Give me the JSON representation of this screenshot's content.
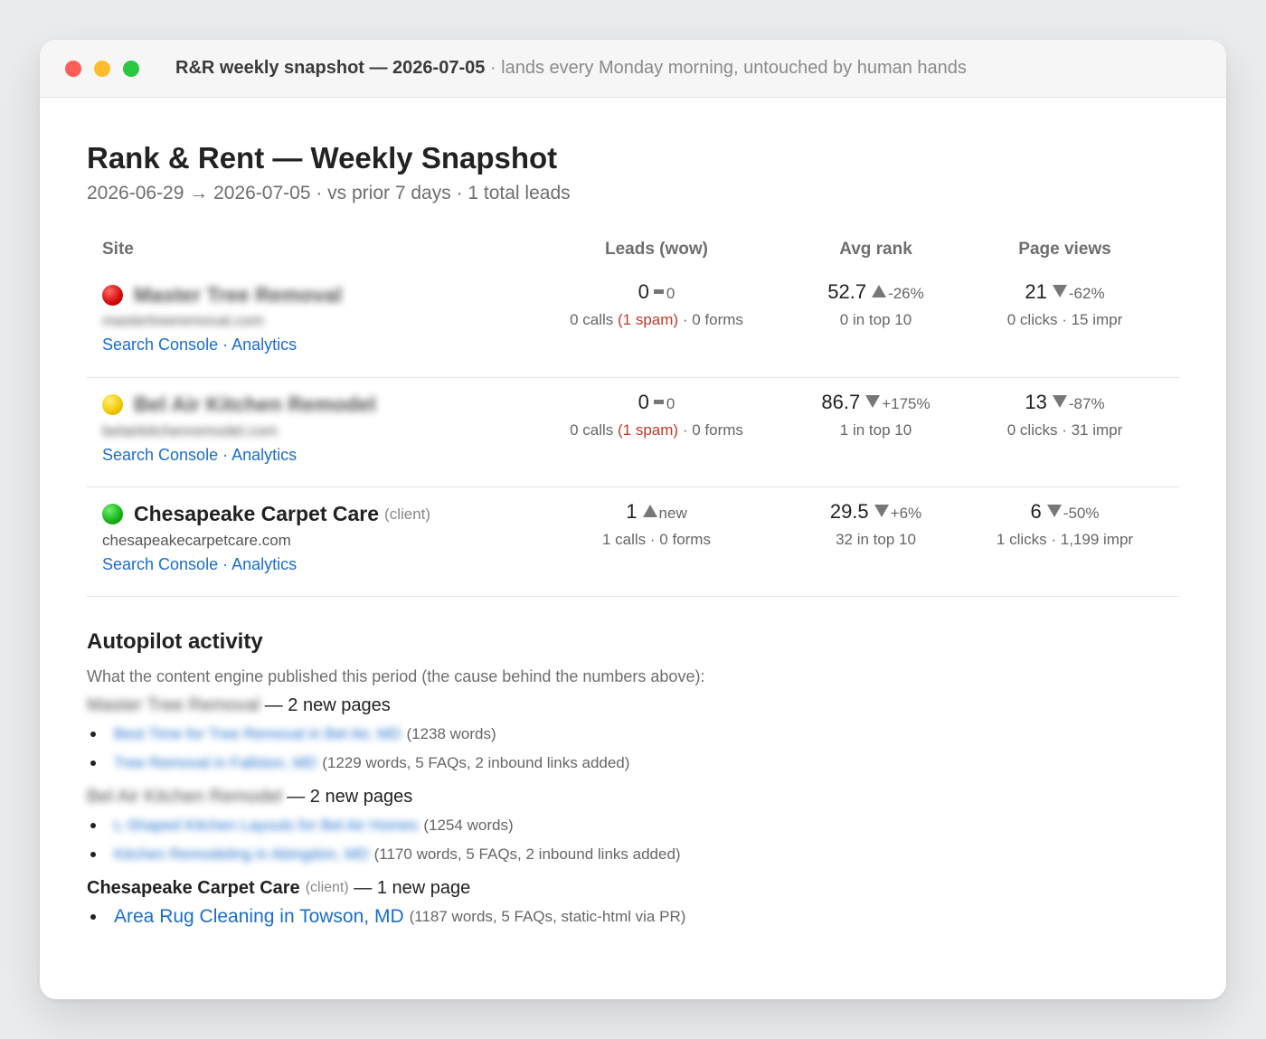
{
  "window": {
    "title_bold": "R&R weekly snapshot — 2026-07-05",
    "title_sub": "· lands every Monday morning, untouched by human hands"
  },
  "report": {
    "heading": "Rank & Rent — Weekly Snapshot",
    "subtitle": "2026-06-29 → 2026-07-05 · vs prior 7 days · 1 total leads"
  },
  "table": {
    "headers": {
      "site": "Site",
      "leads": "Leads (wow)",
      "rank": "Avg rank",
      "pageviews": "Page views"
    },
    "link_search_console": "Search Console",
    "link_sep": " · ",
    "link_analytics": "Analytics",
    "rows": [
      {
        "status": "red",
        "site_name": "Master Tree Removal",
        "domain": "mastertreeremoval.com",
        "leads_value": "0",
        "leads_change": "0",
        "leads_calls": "0 calls",
        "leads_spam": "(1 spam)",
        "leads_forms": "· 0 forms",
        "rank_value": "52.7",
        "rank_change": "-26%",
        "rank_detail": "0 in top 10",
        "pv_value": "21",
        "pv_change": "-62%",
        "pv_detail": "0 clicks · 15 impr"
      },
      {
        "status": "yellow",
        "site_name": "Bel Air Kitchen Remodel",
        "domain": "belairkitchenremodel.com",
        "leads_value": "0",
        "leads_change": "0",
        "leads_calls": "0 calls",
        "leads_spam": "(1 spam)",
        "leads_forms": "· 0 forms",
        "rank_value": "86.7",
        "rank_change": "+175%",
        "rank_detail": "1 in top 10",
        "pv_value": "13",
        "pv_change": "-87%",
        "pv_detail": "0 clicks · 31 impr"
      },
      {
        "status": "green",
        "site_name": "Chesapeake Carpet Care",
        "site_tag": "(client)",
        "domain": "chesapeakecarpetcare.com",
        "leads_value": "1",
        "leads_change": "new",
        "leads_detail": "1 calls · 0 forms",
        "rank_value": "29.5",
        "rank_change": "+6%",
        "rank_detail": "32 in top 10",
        "pv_value": "6",
        "pv_change": "-50%",
        "pv_detail": "1 clicks · 1,199 impr"
      }
    ]
  },
  "autopilot": {
    "heading": "Autopilot activity",
    "description": "What the content engine published this period (the cause behind the numbers above):",
    "groups": [
      {
        "site": "Master Tree Removal",
        "count": "— 2 new pages",
        "pages": [
          {
            "title": "Best Time for Tree Removal in Bel Air, MD",
            "meta": "(1238 words)"
          },
          {
            "title": "Tree Removal in Fallston, MD",
            "meta": "(1229 words, 5 FAQs, 2 inbound links added)"
          }
        ]
      },
      {
        "site": "Bel Air Kitchen Remodel",
        "count": "— 2 new pages",
        "pages": [
          {
            "title": "L-Shaped Kitchen Layouts for Bel Air Homes",
            "meta": "(1254 words)"
          },
          {
            "title": "Kitchen Remodeling in Abingdon, MD",
            "meta": "(1170 words, 5 FAQs, 2 inbound links added)"
          }
        ]
      },
      {
        "site": "Chesapeake Carpet Care",
        "tag": "(client)",
        "count": "— 1 new page",
        "pages": [
          {
            "title": "Area Rug Cleaning in Towson, MD",
            "meta": "(1187 words, 5 FAQs, static-html via PR)"
          }
        ]
      }
    ]
  }
}
